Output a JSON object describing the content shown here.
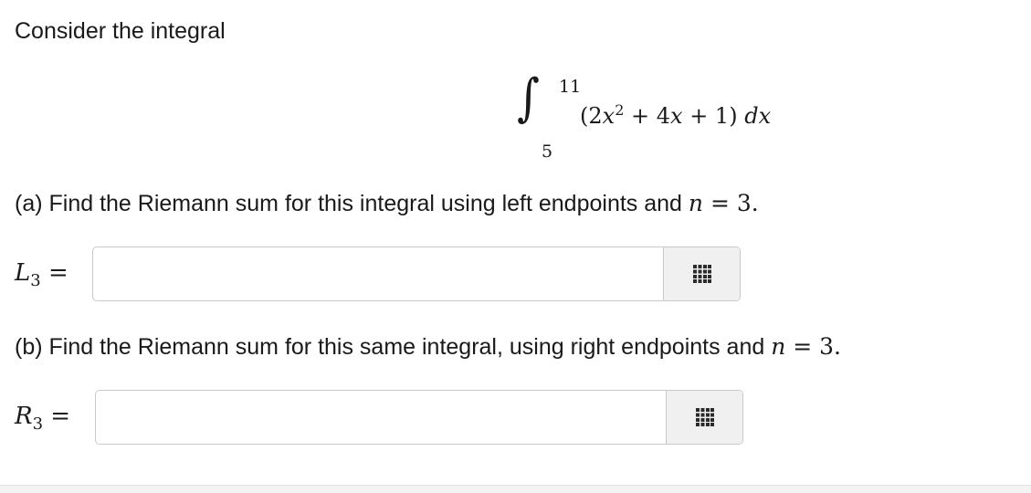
{
  "intro": "Consider the integral",
  "integral": {
    "upper_limit": "11",
    "lower_limit": "5",
    "open_paren": "(2",
    "var": "x",
    "exponent": "2",
    "rest_1": " + 4",
    "var2": "x",
    "rest_2": " + 1) ",
    "dx": "dx"
  },
  "part_a": {
    "text": "(a) Find the Riemann sum for this integral using left endpoints and ",
    "n_var": "n",
    "n_eq": " = 3.",
    "label_letter": "L",
    "label_sub": "3",
    "label_eq": " =",
    "input_value": ""
  },
  "part_b": {
    "text": "(b) Find the Riemann sum for this same integral, using right endpoints and ",
    "n_var": "n",
    "n_eq": " = 3.",
    "label_letter": "R",
    "label_sub": "3",
    "label_eq": " =",
    "input_value": ""
  },
  "icons": {
    "keypad": "keypad-grid-icon"
  },
  "colors": {
    "keypad_dots": "#2b2b2b",
    "keypad_bg": "#f0f0f0",
    "border": "#c9c9c9"
  }
}
